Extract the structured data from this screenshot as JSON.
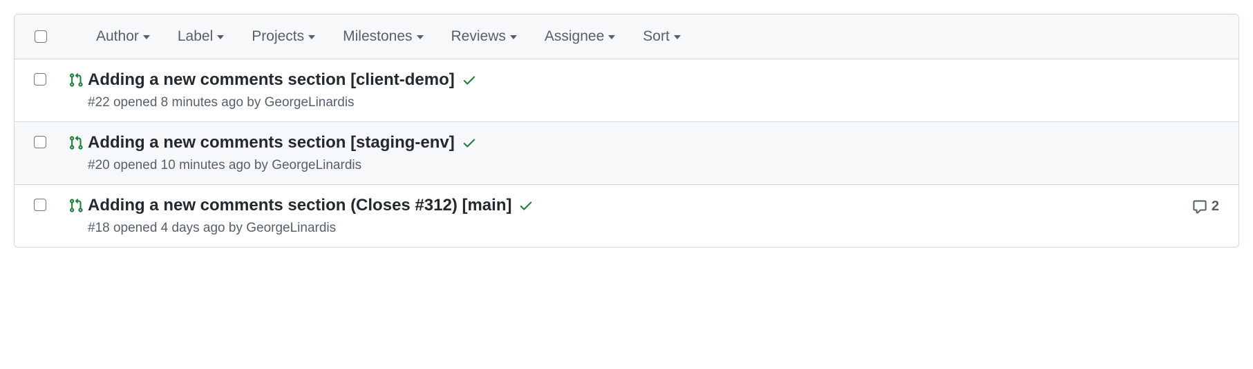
{
  "filters": {
    "author": "Author",
    "label": "Label",
    "projects": "Projects",
    "milestones": "Milestones",
    "reviews": "Reviews",
    "assignee": "Assignee",
    "sort": "Sort"
  },
  "pull_requests": [
    {
      "title": "Adding a new comments section [client-demo]",
      "meta": "#22 opened 8 minutes ago by GeorgeLinardis",
      "comments": null
    },
    {
      "title": "Adding a new comments section [staging-env]",
      "meta": "#20 opened 10 minutes ago by GeorgeLinardis",
      "comments": null
    },
    {
      "title": "Adding a new comments section (Closes #312) [main]",
      "meta": "#18 opened 4 days ago by GeorgeLinardis",
      "comments": "2"
    }
  ]
}
